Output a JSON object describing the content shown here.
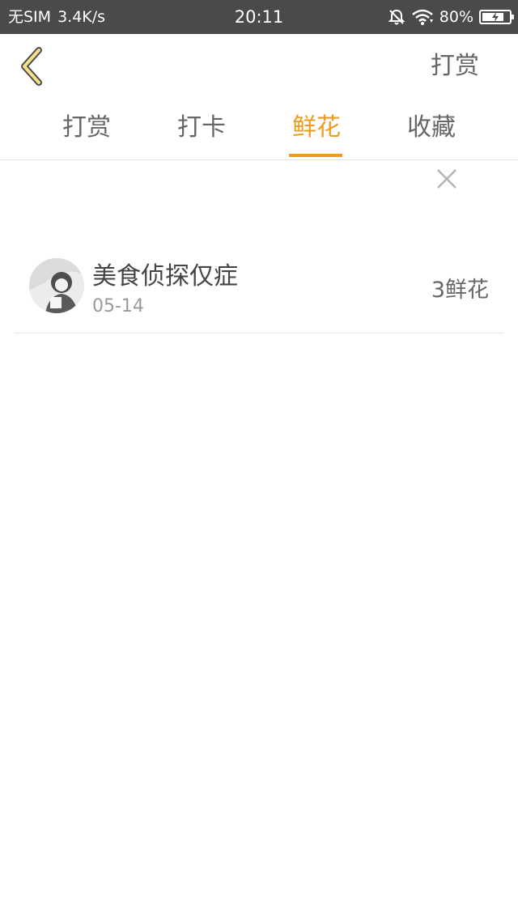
{
  "status_bar": {
    "carrier": "无SIM",
    "speed": "3.4K/s",
    "time": "20:11",
    "battery_text": "80%",
    "battery_level": 0.8,
    "icons": [
      "bell-muted-icon",
      "wifi-icon",
      "battery-charging-icon"
    ]
  },
  "nav": {
    "back_icon": "chevron-left-icon",
    "action_label": "打赏"
  },
  "tabs": [
    {
      "label": "打赏",
      "active": false
    },
    {
      "label": "打卡",
      "active": false
    },
    {
      "label": "鲜花",
      "active": true
    },
    {
      "label": "收藏",
      "active": false
    }
  ],
  "close_icon": "close-icon",
  "list": [
    {
      "name": "美食侦探仅症",
      "date": "05-14",
      "count": "3鲜花",
      "avatar_icon": "avatar-photo"
    }
  ],
  "colors": {
    "accent": "#ef9c1c",
    "status_bar_bg": "#4a4a4a",
    "text_primary": "#444444",
    "text_secondary": "#9a9a9a",
    "divider": "#e8e8e8"
  }
}
